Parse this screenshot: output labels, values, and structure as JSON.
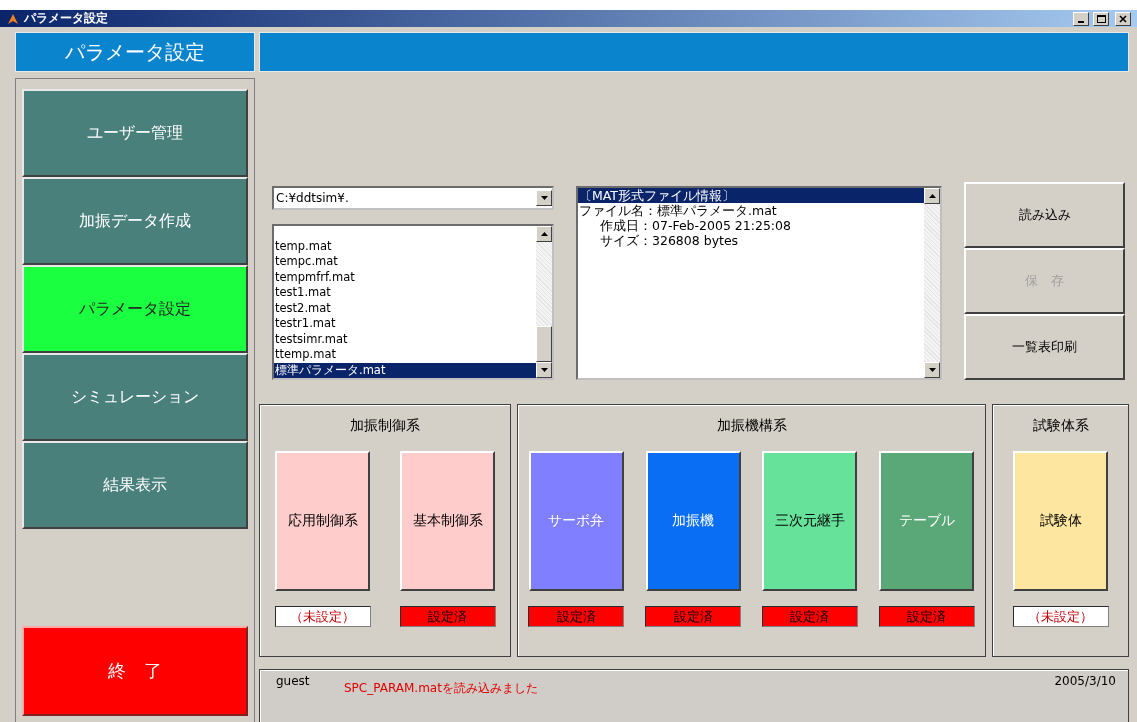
{
  "window": {
    "title": "パラメータ設定"
  },
  "header": {
    "title": "パラメータ設定"
  },
  "nav": [
    {
      "label": "ユーザー管理",
      "selected": false
    },
    {
      "label": "加振データ作成",
      "selected": false
    },
    {
      "label": "パラメータ設定",
      "selected": true
    },
    {
      "label": "シミュレーション",
      "selected": false
    },
    {
      "label": "結果表示",
      "selected": false
    }
  ],
  "exit_button": "終　了",
  "folder": {
    "value": "C:¥ddtsim¥."
  },
  "files": [
    {
      "name": "temp.mat",
      "selected": false
    },
    {
      "name": "tempc.mat",
      "selected": false
    },
    {
      "name": "tempmfrf.mat",
      "selected": false
    },
    {
      "name": "test1.mat",
      "selected": false
    },
    {
      "name": "test2.mat",
      "selected": false
    },
    {
      "name": "testr1.mat",
      "selected": false
    },
    {
      "name": "testsimr.mat",
      "selected": false
    },
    {
      "name": "ttemp.mat",
      "selected": false
    },
    {
      "name": "標準パラメータ.mat",
      "selected": true
    }
  ],
  "info": [
    {
      "text": "〔MAT形式ファイル情報〕",
      "selected": true,
      "indent": false
    },
    {
      "text": "ファイル名：標準パラメータ.mat",
      "selected": false,
      "indent": false
    },
    {
      "text": "作成日：07-Feb-2005 21:25:08",
      "selected": false,
      "indent": true
    },
    {
      "text": "サイズ：326808 bytes",
      "selected": false,
      "indent": true
    }
  ],
  "actions": [
    {
      "label": "読み込み",
      "disabled": false
    },
    {
      "label": "保　存",
      "disabled": true
    },
    {
      "label": "一覧表印刷",
      "disabled": false
    }
  ],
  "groups": [
    {
      "title": "加振制御系",
      "items": [
        {
          "label": "応用制御系",
          "color": "#ffcccc",
          "status": "（未設定）",
          "set": false
        },
        {
          "label": "基本制御系",
          "color": "#ffcccc",
          "status": "設定済",
          "set": true
        }
      ]
    },
    {
      "title": "加振機構系",
      "items": [
        {
          "label": "サーボ弁",
          "color": "#7f7fff",
          "status": "設定済",
          "set": true
        },
        {
          "label": "加振機",
          "color": "#0a6ef5",
          "status": "設定済",
          "set": true
        },
        {
          "label": "三次元継手",
          "color": "#66e29b",
          "status": "設定済",
          "set": true
        },
        {
          "label": "テーブル",
          "color": "#5aa878",
          "status": "設定済",
          "set": true
        }
      ]
    },
    {
      "title": "試験体系",
      "items": [
        {
          "label": "試験体",
          "color": "#fde6a0",
          "status": "（未設定）",
          "set": false
        }
      ]
    }
  ],
  "status_bar": {
    "user": "guest",
    "message": "SPC_PARAM.matを読み込みました",
    "date": "2005/3/10"
  }
}
